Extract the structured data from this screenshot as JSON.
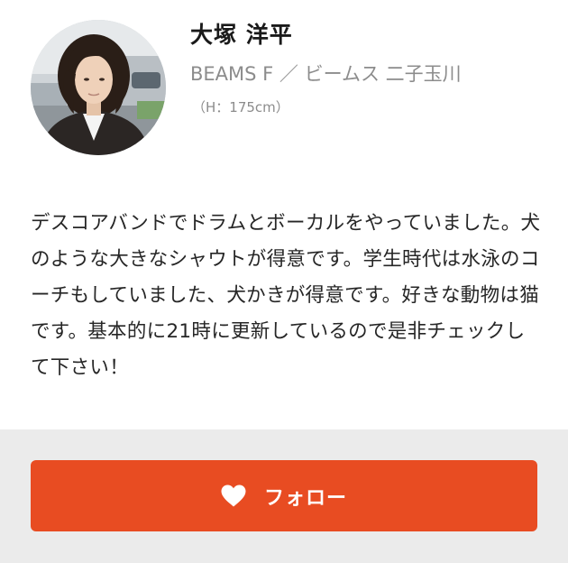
{
  "profile": {
    "name": "大塚 洋平",
    "shop": "BEAMS F ／ ビームス 二子玉川",
    "height": "（H：175cm）",
    "bio": "デスコアバンドでドラムとボーカルをやっていました。犬のような大きなシャウトが得意です。学生時代は水泳のコーチもしていました、犬かきが得意です。好きな動物は猫です。基本的に21時に更新しているので是非チェックして下さい！"
  },
  "footer": {
    "follow_label": "フォロー",
    "follow_icon": "heart-icon"
  },
  "colors": {
    "accent": "#e84c22",
    "footer_bg": "#ebebeb",
    "muted_text": "#8c8c8c"
  }
}
